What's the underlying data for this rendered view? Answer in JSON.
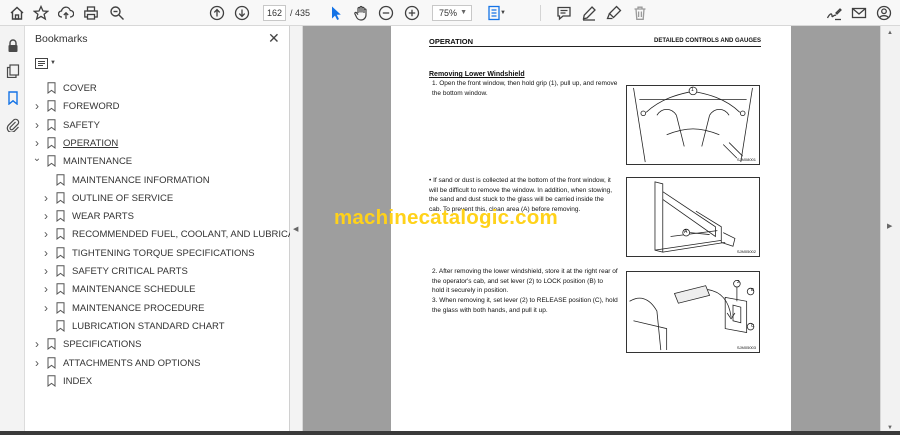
{
  "toolbar": {
    "current_page": "162",
    "page_total": "/ 435",
    "zoom": "75%"
  },
  "bookmarks": {
    "title": "Bookmarks",
    "items": [
      {
        "label": "COVER",
        "expandable": false,
        "level": 0
      },
      {
        "label": "FOREWORD",
        "expandable": true,
        "level": 0
      },
      {
        "label": "SAFETY",
        "expandable": true,
        "level": 0
      },
      {
        "label": "OPERATION",
        "expandable": true,
        "level": 0,
        "active": true
      },
      {
        "label": "MAINTENANCE",
        "expandable": true,
        "expanded": true,
        "level": 0
      },
      {
        "label": "MAINTENANCE INFORMATION",
        "expandable": false,
        "level": 1
      },
      {
        "label": "OUTLINE OF SERVICE",
        "expandable": true,
        "level": 1
      },
      {
        "label": "WEAR PARTS",
        "expandable": true,
        "level": 1
      },
      {
        "label": "RECOMMENDED FUEL, COOLANT, AND LUBRICANT",
        "expandable": true,
        "level": 1
      },
      {
        "label": "TIGHTENING TORQUE SPECIFICATIONS",
        "expandable": true,
        "level": 1
      },
      {
        "label": "SAFETY CRITICAL PARTS",
        "expandable": true,
        "level": 1
      },
      {
        "label": "MAINTENANCE SCHEDULE",
        "expandable": true,
        "level": 1
      },
      {
        "label": "MAINTENANCE PROCEDURE",
        "expandable": true,
        "level": 1
      },
      {
        "label": "LUBRICATION STANDARD CHART",
        "expandable": false,
        "level": 1
      },
      {
        "label": "SPECIFICATIONS",
        "expandable": true,
        "level": 0
      },
      {
        "label": "ATTACHMENTS AND OPTIONS",
        "expandable": true,
        "level": 0
      },
      {
        "label": "INDEX",
        "expandable": false,
        "level": 0
      }
    ]
  },
  "document": {
    "header_left": "OPERATION",
    "header_right": "DETAILED CONTROLS AND GAUGES",
    "section_title": "Removing Lower Windshield",
    "step1": [
      "1.  Open the front window, then hold grip (1), pull up, and remove",
      "     the bottom window."
    ],
    "note": [
      "•  If sand or dust is collected at the bottom of the front window, it",
      "    will be difficult to remove the window. In addition, when stowing,",
      "    the sand and dust stuck to the glass will be carried inside the",
      "    cab. To prevent this, clean area (A) before removing."
    ],
    "step2": [
      "2.  After removing the lower windshield, store it at the right rear of",
      "     the operator's cab, and set lever (2) to LOCK position (B) to",
      "     hold it securely in position."
    ],
    "step3": [
      "3.  When removing it, set lever (2) to RELEASE position (C), hold",
      "     the glass with both hands, and pull it up."
    ],
    "fig1_code": "SJM08001",
    "fig2_code": "SJM05002",
    "fig3_code": "SJM05003",
    "fig1_callout": "1",
    "fig2_callout": "A",
    "fig3_callouts": [
      "2",
      "B",
      "C"
    ]
  },
  "watermark": "machinecatalogic.com",
  "colors": {
    "watermark": "#ffd21a",
    "viewport_bg": "#9e9e9e",
    "toolbar_bg": "#f8f8f8",
    "select_tool": "#1473e6"
  },
  "icons": [
    "home-icon",
    "star-icon",
    "upload-icon",
    "print-icon",
    "zoom-search-icon",
    "page-up-icon",
    "page-down-icon",
    "select-pointer-icon",
    "hand-icon",
    "zoom-out-icon",
    "zoom-in-icon",
    "page-fit-icon",
    "comment-icon",
    "pen-icon",
    "highlight-icon",
    "delete-icon",
    "sign-icon",
    "mail-icon",
    "account-icon",
    "lock-icon",
    "pages-icon",
    "bookmark-icon",
    "paperclip-icon"
  ]
}
